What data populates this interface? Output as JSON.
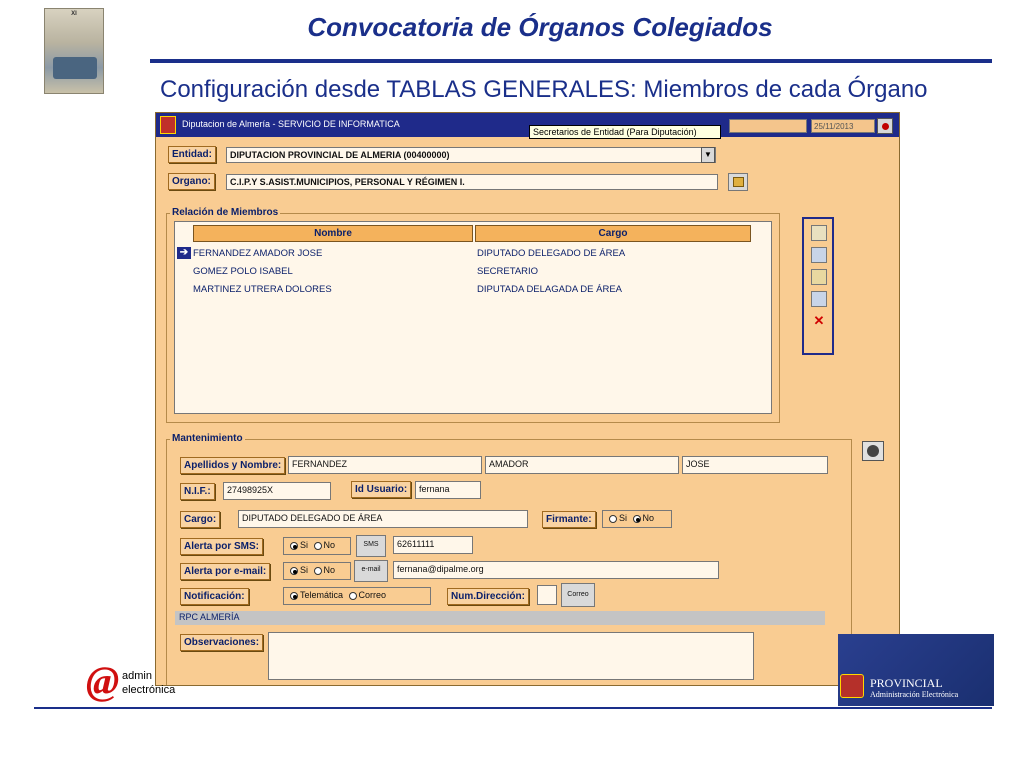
{
  "slide": {
    "title": "Convocatoria de Órganos Colegiados",
    "subtitle": "Configuración desde TABLAS GENERALES: Miembros de cada Órgano",
    "thumbnail_heading": "XI"
  },
  "window": {
    "title": "Diputacion de Almería  - SERVICIO DE INFORMATICA",
    "tooltip": "Secretarios de Entidad (Para Diputación)",
    "date": "25/11/2013"
  },
  "form": {
    "entidad_label": "Entidad:",
    "entidad_value": "DIPUTACION PROVINCIAL DE ALMERIA  (00400000)",
    "organo_label": "Organo:",
    "organo_value": "C.I.P.Y S.ASIST.MUNICIPIOS, PERSONAL Y RÉGIMEN I."
  },
  "members": {
    "group_title": "Relación de Miembros",
    "columns": [
      "Nombre",
      "Cargo"
    ],
    "rows": [
      {
        "nombre": "FERNANDEZ AMADOR JOSE",
        "cargo": "DIPUTADO DELEGADO DE ÁREA",
        "selected": true
      },
      {
        "nombre": "GOMEZ POLO ISABEL",
        "cargo": "SECRETARIO",
        "selected": false
      },
      {
        "nombre": "MARTINEZ UTRERA DOLORES",
        "cargo": "DIPUTADA DELAGADA DE ÁREA",
        "selected": false
      }
    ],
    "row_pointer": "➔"
  },
  "toolbar_icons": [
    "new-icon",
    "save-icon",
    "edit-icon",
    "print-icon",
    "delete-icon"
  ],
  "maintenance": {
    "group_title": "Mantenimiento",
    "apellidos_label": "Apellidos y Nombre:",
    "apellido1": "FERNANDEZ",
    "apellido2": "AMADOR",
    "nombre": "JOSE",
    "nif_label": "N.I.F.:",
    "nif_value": "27498925X",
    "id_usuario_label": "Id Usuario:",
    "id_usuario_value": "fernana",
    "cargo_label": "Cargo:",
    "cargo_value": "DIPUTADO DELEGADO DE ÁREA",
    "firmante_label": "Firmante:",
    "firmante_si": "Si",
    "firmante_no": "No",
    "firmante_selected": "No",
    "sms_label": "Alerta por SMS:",
    "sms_si": "Si",
    "sms_no": "No",
    "sms_selected": "Si",
    "sms_button": "SMS",
    "sms_value": "62611111",
    "email_label": "Alerta por e-mail:",
    "email_si": "Si",
    "email_no": "No",
    "email_selected": "Si",
    "email_button": "e-mail",
    "email_value": "fernana@dipalme.org",
    "notif_label": "Notificación:",
    "notif_telematica": "Telemática",
    "notif_correo": "Correo",
    "notif_selected": "Telemática",
    "numdir_label": "Num.Dirección:",
    "numdir_value": "",
    "correo_button": "Correo",
    "rpc_text": "RPC ALMERÍA",
    "obs_label": "Observaciones:",
    "obs_value": ""
  },
  "footer": {
    "left_logo_line1": "admin",
    "left_logo_line2": "electrónica",
    "left_logo_symbol": "@",
    "right_logo_line1": "PROVINCIAL",
    "right_logo_line2": "Administración Electrónica"
  },
  "colors": {
    "slide_blue": "#1a2f8a",
    "window_bg": "#f9cc92",
    "titlebar": "#1f2a8a",
    "header_cell": "#f4b25c"
  }
}
